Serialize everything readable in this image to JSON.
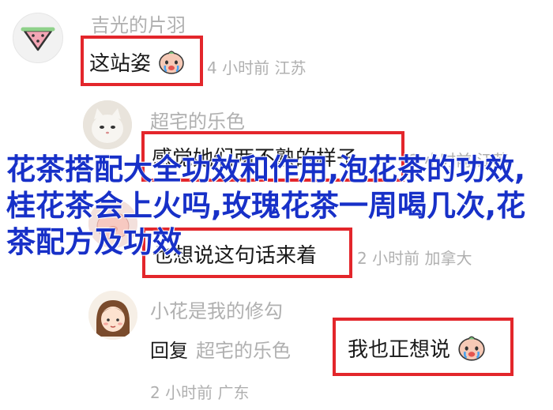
{
  "overlay": {
    "title": "花茶搭配大全功效和作用,泡花茶的功效,桂花茶会上火吗,玫瑰花茶一周喝几次,花茶配方及功效"
  },
  "comments": [
    {
      "username": "吉光的片羽",
      "text": "这站姿",
      "meta": "4 小时前 江苏",
      "avatar_icon": "watermelon-icon",
      "emoji": "crying-face-icon"
    },
    {
      "username": "超宅的乐色",
      "text": "感觉她们两不熟的样子",
      "meta": "2 小时前 江苏",
      "avatar_icon": "cat-avatar-icon"
    },
    {
      "username": "",
      "text": "也想说这句话来着",
      "meta": "2 小时前 加拿大",
      "avatar_icon": "pig-avatar-icon"
    },
    {
      "username": "小花是我的修勾",
      "reply_label": "回复",
      "reply_to": "超宅的乐色",
      "text": "我也正想说",
      "meta": "2 小时前 广东",
      "avatar_icon": "girl-avatar-icon",
      "emoji": "crying-face-icon"
    }
  ],
  "colors": {
    "highlight_box": "#e3262b",
    "overlay_text": "#1730c8",
    "muted_text": "#b0b0b0"
  }
}
